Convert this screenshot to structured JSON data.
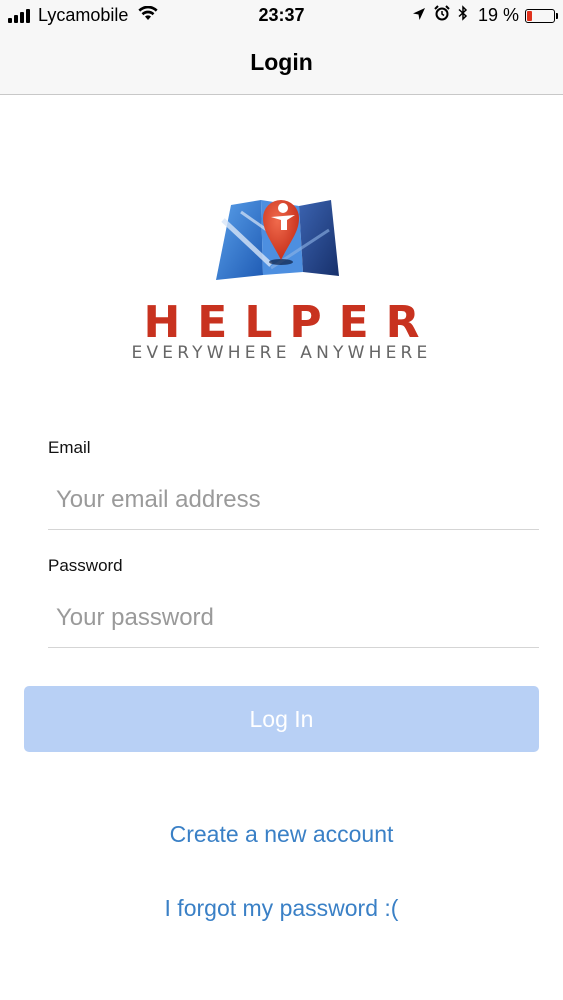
{
  "status_bar": {
    "carrier": "Lycamobile",
    "time": "23:37",
    "battery_percent": "19 %",
    "battery_level": 0.19,
    "icons": [
      "signal-icon",
      "wifi-icon",
      "location-icon",
      "alarm-icon",
      "bluetooth-icon",
      "battery-icon"
    ]
  },
  "nav": {
    "title": "Login"
  },
  "logo": {
    "word": "HELPER",
    "tagline": "EVERYWHERE ANYWHERE",
    "colors": {
      "red": "#c8321f",
      "blue": "#2a6fc9",
      "navy": "#1e3f82"
    }
  },
  "form": {
    "email_label": "Email",
    "email_placeholder": "Your email address",
    "email_value": "",
    "password_label": "Password",
    "password_placeholder": "Your password",
    "password_value": "",
    "login_label": "Log In"
  },
  "links": {
    "create_account": "Create a new account",
    "forgot_password": "I forgot my password :("
  },
  "colors": {
    "button_disabled": "#b8d0f5",
    "link": "#3a80c6"
  }
}
